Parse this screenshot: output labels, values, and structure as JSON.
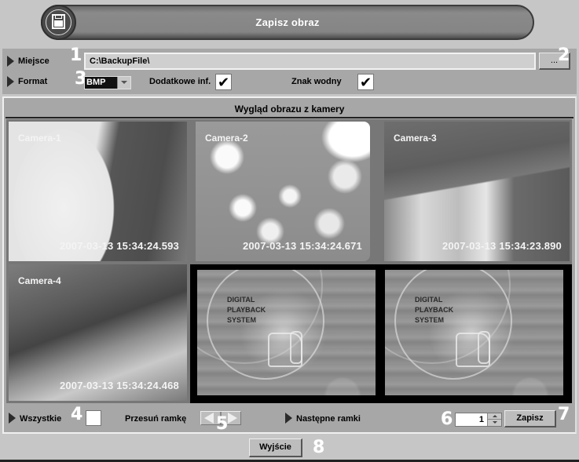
{
  "window": {
    "title": "Zapisz obraz",
    "icon": "floppy-disk-icon"
  },
  "top": {
    "location": {
      "label": "Miejsce",
      "value": "C:\\BackupFile\\",
      "marker": "1"
    },
    "browse": {
      "label": "...",
      "marker": "2"
    },
    "format": {
      "label": "Format",
      "value": "BMP",
      "marker": "3"
    },
    "extra_info": {
      "label": "Dodatkowe inf.",
      "checked": true,
      "glyph": "✔"
    },
    "watermark": {
      "label": "Znak wodny",
      "checked": true,
      "glyph": "✔"
    }
  },
  "preview": {
    "header": "Wygląd obrazu z kamery",
    "cameras": [
      {
        "name": "Camera-1",
        "timestamp": "2007-03-13  15:34:24.593"
      },
      {
        "name": "Camera-2",
        "timestamp": "2007-03-13  15:34:24.671"
      },
      {
        "name": "Camera-3",
        "timestamp": "2007-03-13  15:34:23.890"
      },
      {
        "name": "Camera-4",
        "timestamp": "2007-03-13  15:34:24.468"
      }
    ],
    "placeholders": [
      {
        "lines": [
          "DIGITAL",
          "PLAYBACK",
          "SYSTEM"
        ]
      },
      {
        "lines": [
          "DIGITAL",
          "PLAYBACK",
          "SYSTEM"
        ]
      }
    ]
  },
  "bottom": {
    "all": {
      "label": "Wszystkie",
      "checked": false,
      "marker": "4"
    },
    "shift": {
      "label": "Przesuń ramkę",
      "marker": "5"
    },
    "next": {
      "label": "Następne ramki"
    },
    "count": {
      "value": "1",
      "marker": "6"
    },
    "save": {
      "label": "Zapisz",
      "marker": "7"
    },
    "exit": {
      "label": "Wyjście",
      "marker": "8"
    }
  },
  "colors": {
    "background": "#c6c6c6",
    "panel": "#a7a7a7",
    "title_bar": "#858585"
  }
}
